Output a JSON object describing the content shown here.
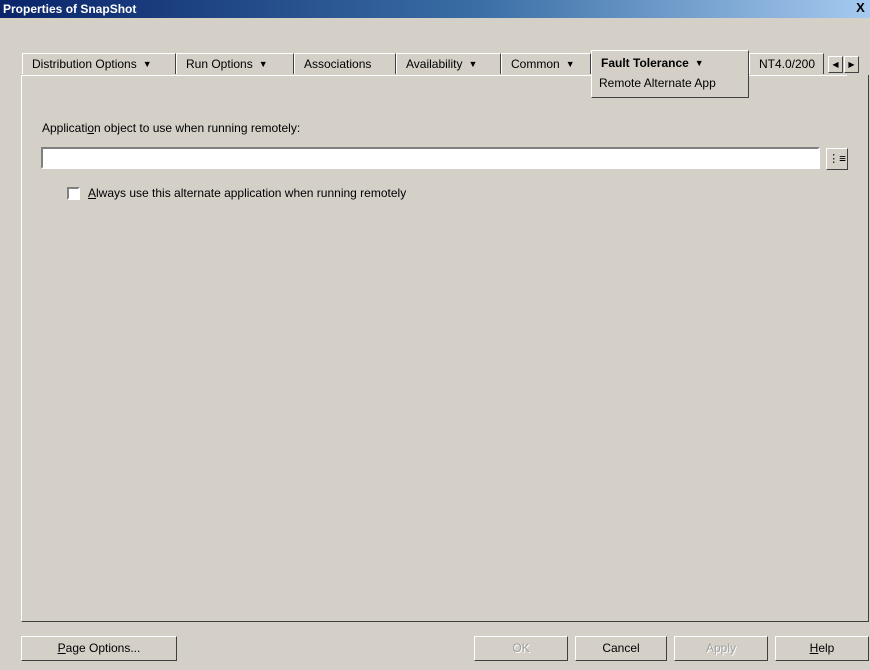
{
  "window": {
    "title": "Properties of SnapShot",
    "close_glyph": "X"
  },
  "tabs": [
    {
      "label": "Distribution Options",
      "has_menu": true
    },
    {
      "label": "Run Options",
      "has_menu": true
    },
    {
      "label": "Associations",
      "has_menu": false
    },
    {
      "label": "Availability",
      "has_menu": true
    },
    {
      "label": "Common",
      "has_menu": true
    },
    {
      "label": "Fault Tolerance",
      "has_menu": true,
      "active": true,
      "subtab": "Remote Alternate App"
    },
    {
      "label": "NT4.0/200",
      "has_menu": false
    }
  ],
  "caret_glyph": "▼",
  "scroll": {
    "left_glyph": "◀",
    "right_glyph": "▶"
  },
  "form": {
    "label_prefix": "Applicati",
    "label_accel": "o",
    "label_suffix": "n object to use when running remotely:",
    "input_value": "",
    "browse_icon_glyph": "⋮≡",
    "checkbox_checked": false,
    "checkbox_accel": "A",
    "checkbox_label_rest": "lways use this alternate application when running remotely"
  },
  "buttons": {
    "page_options_accel": "P",
    "page_options_rest": "age Options...",
    "ok": "OK",
    "cancel": "Cancel",
    "apply": "Apply",
    "help_accel": "H",
    "help_rest": "elp"
  },
  "colors": {
    "face": "#d4d0c8",
    "titlebar_start": "#0a246a",
    "titlebar_end": "#a6caf0"
  }
}
